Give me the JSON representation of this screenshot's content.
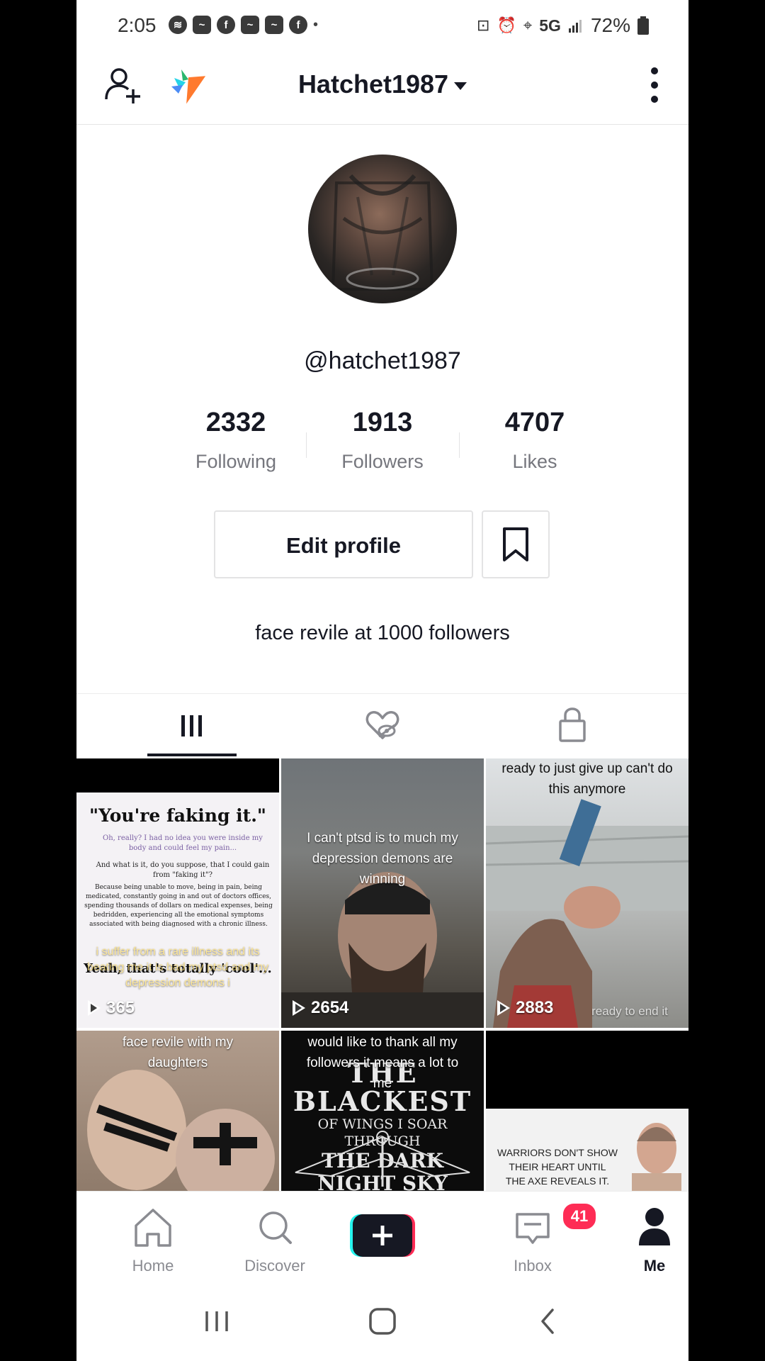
{
  "status_bar": {
    "time": "2:05",
    "network": "5G",
    "battery": "72%",
    "notification_icons": [
      "spotify-icon",
      "app-icon",
      "facebook-icon",
      "app-icon",
      "app-icon",
      "facebook-icon",
      "dot-icon"
    ]
  },
  "header": {
    "title": "Hatchet1987"
  },
  "profile": {
    "handle": "@hatchet1987",
    "stats": [
      {
        "value": "2332",
        "label": "Following"
      },
      {
        "value": "1913",
        "label": "Followers"
      },
      {
        "value": "4707",
        "label": "Likes"
      }
    ],
    "edit_label": "Edit profile",
    "bio": "face revile at 1000 followers"
  },
  "grid": [
    {
      "views": "365",
      "caption_top": "",
      "caption_bottom": "i suffer from a rare illness and its beating me it is bad my ptsd and my depression demons i"
    },
    {
      "views": "2654",
      "caption_top": "I can't ptsd is to much my depression demons are winning",
      "caption_bottom": ""
    },
    {
      "views": "2883",
      "caption_top": "ready to just give up can't do this anymore",
      "caption_bottom": "ready to end it"
    },
    {
      "views": "",
      "caption_top": "face revile with my daughters",
      "caption_bottom": ""
    },
    {
      "views": "",
      "caption_top": "would like to thank all my followers it means a lot to me",
      "caption_bottom": ""
    },
    {
      "views": "",
      "caption_top": "",
      "caption_bottom": ""
    }
  ],
  "grid_artwork": {
    "quote_title": "\"You're faking it.\"",
    "quote_lines": [
      "Oh, really? I had no idea you were inside my body and could feel my pain...",
      "And what is it, do you suppose, that I could gain from \"faking it\"?",
      "Because being unable to move, being in pain, being medicated, constantly going in and out of doctors offices, spending thousands of dollars on medical expenses, being bedridden, experiencing all the emotional symptoms associated with being diagnosed with a chronic illness."
    ],
    "quote_footer": "Yeah, that's totally 'cool'...",
    "raven_text_1": "ON THE",
    "raven_text_2": "THE BLACKEST",
    "raven_text_3": "OF WINGS I SOAR THROUGH",
    "raven_text_4": "THE DARK NIGHT SKY",
    "warriors_lines": [
      "WARRIORS DON'T SHOW",
      "THEIR HEART UNTIL",
      "THE AXE REVEALS IT."
    ]
  },
  "bottom_nav": {
    "items": [
      {
        "label": "Home"
      },
      {
        "label": "Discover"
      },
      {
        "label": "Inbox",
        "badge": "41"
      },
      {
        "label": "Me"
      }
    ]
  },
  "colors": {
    "text": "#161823",
    "secondary": "#75767d",
    "badge": "#fe2c55",
    "plus_cyan": "#25f4ee",
    "plus_red": "#fe2c55"
  }
}
